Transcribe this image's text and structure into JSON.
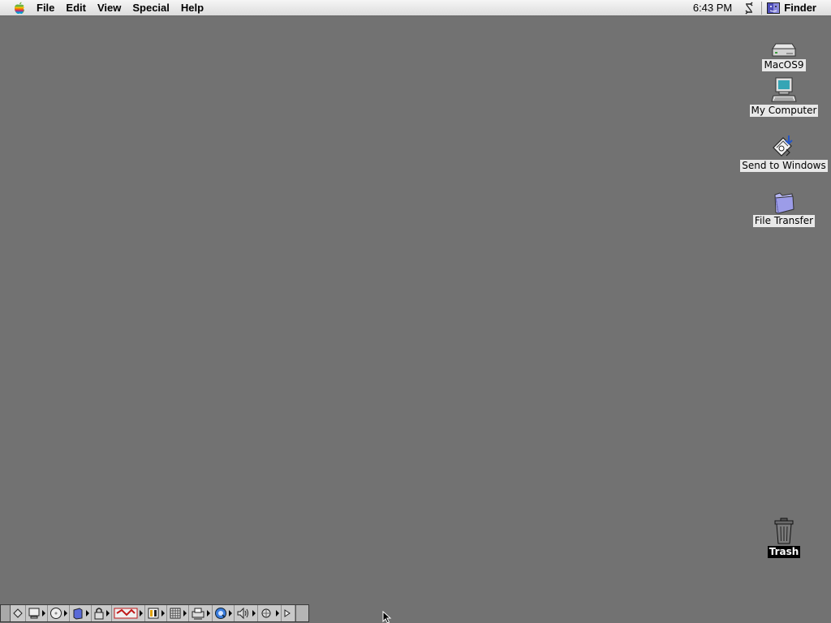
{
  "menubar": {
    "apple_icon": "apple-rainbow-icon",
    "items": [
      {
        "label": "File"
      },
      {
        "label": "Edit"
      },
      {
        "label": "View"
      },
      {
        "label": "Special"
      },
      {
        "label": "Help"
      }
    ],
    "clock": "6:43 PM",
    "sync_icon": "file-sync-icon",
    "app_label": "Finder",
    "app_icon": "finder-icon"
  },
  "desktop": {
    "background_color": "#727272",
    "icons": [
      {
        "label": "MacOS9",
        "icon": "hard-disk-icon",
        "selected": false
      },
      {
        "label": "My Computer",
        "icon": "pc-computer-icon",
        "selected": false
      },
      {
        "label": "Send to Windows",
        "icon": "send-to-windows-icon",
        "selected": false
      },
      {
        "label": "File Transfer",
        "icon": "folder-icon",
        "selected": false
      },
      {
        "label": "Trash",
        "icon": "trash-icon",
        "selected": true
      }
    ]
  },
  "control_strip": {
    "modules": [
      "apple-talk-icon",
      "cd-icon",
      "display-icon",
      "file-sharing-icon",
      "keychain-lock-icon",
      "location-manager-icon",
      "monitor-bit-depth-icon",
      "monitor-resolution-icon",
      "printer-icon",
      "quicktime-icon",
      "sound-volume-icon",
      "speech-icon",
      "web-sharing-icon"
    ]
  }
}
